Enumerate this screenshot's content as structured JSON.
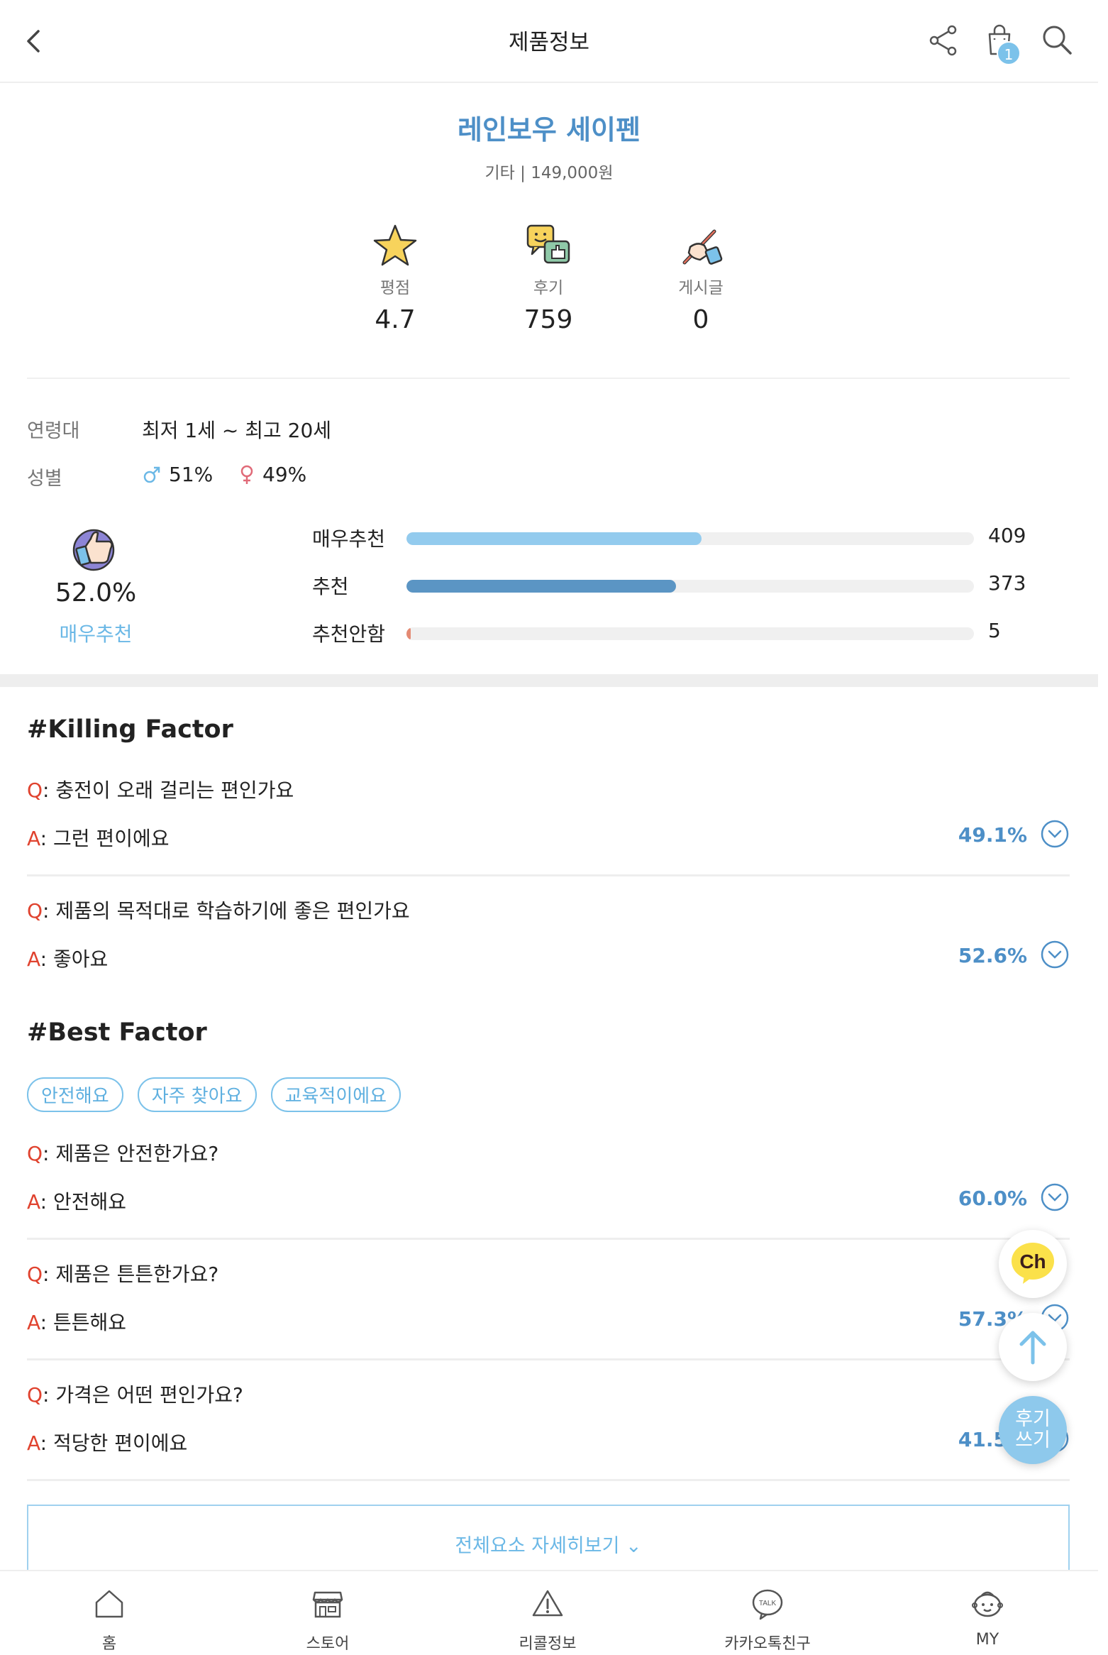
{
  "header": {
    "title": "제품정보",
    "cart_badge": "1"
  },
  "product": {
    "name": "레인보우 세이펜",
    "meta": "기타 | 149,000원"
  },
  "stats": [
    {
      "label": "평점",
      "value": "4.7"
    },
    {
      "label": "후기",
      "value": "759"
    },
    {
      "label": "게시글",
      "value": "0"
    }
  ],
  "info": {
    "age_label": "연령대",
    "age_value": "최저 1세 ~ 최고 20세",
    "gender_label": "성별",
    "male": "51%",
    "female": "49%"
  },
  "recommend": {
    "percent": "52.0%",
    "label": "매우추천",
    "bars": [
      {
        "label": "매우추천",
        "count": "409",
        "fraction": 0.52,
        "color": "#93cbee"
      },
      {
        "label": "추천",
        "count": "373",
        "fraction": 0.475,
        "color": "#5b95c4"
      },
      {
        "label": "추천안함",
        "count": "5",
        "fraction": 0.007,
        "color": "#e48a73"
      }
    ]
  },
  "killing": {
    "title": "#Killing Factor",
    "items": [
      {
        "q": "충전이 오래 걸리는 편인가요",
        "a": "그런 편이에요",
        "pct": "49.1%"
      },
      {
        "q": "제품의 목적대로 학습하기에 좋은 편인가요",
        "a": "좋아요",
        "pct": "52.6%"
      }
    ]
  },
  "best": {
    "title": "#Best Factor",
    "tags": [
      "안전해요",
      "자주 찾아요",
      "교육적이에요"
    ],
    "items": [
      {
        "q": "제품은 안전한가요?",
        "a": "안전해요",
        "pct": "60.0%"
      },
      {
        "q": "제품은 튼튼한가요?",
        "a": "튼튼해요",
        "pct": "57.3%"
      },
      {
        "q": "가격은 어떤 편인가요?",
        "a": "적당한 편이에요",
        "pct": "41.5%"
      }
    ]
  },
  "qa_marks": {
    "q": "Q",
    "a": "A"
  },
  "more_button": "전체요소 자세히보기 ⌄",
  "fab": {
    "channel": "Ch",
    "write_line1": "후기",
    "write_line2": "쓰기"
  },
  "nav": [
    {
      "label": "홈",
      "icon": "home-icon"
    },
    {
      "label": "스토어",
      "icon": "store-icon"
    },
    {
      "label": "리콜정보",
      "icon": "warning-icon"
    },
    {
      "label": "카카오톡친구",
      "icon": "talk-icon"
    },
    {
      "label": "MY",
      "icon": "baby-face-icon"
    }
  ],
  "colors": {
    "accent": "#4d8fc7",
    "light_accent": "#7cc2ea",
    "question_mark": "#e0432f"
  }
}
